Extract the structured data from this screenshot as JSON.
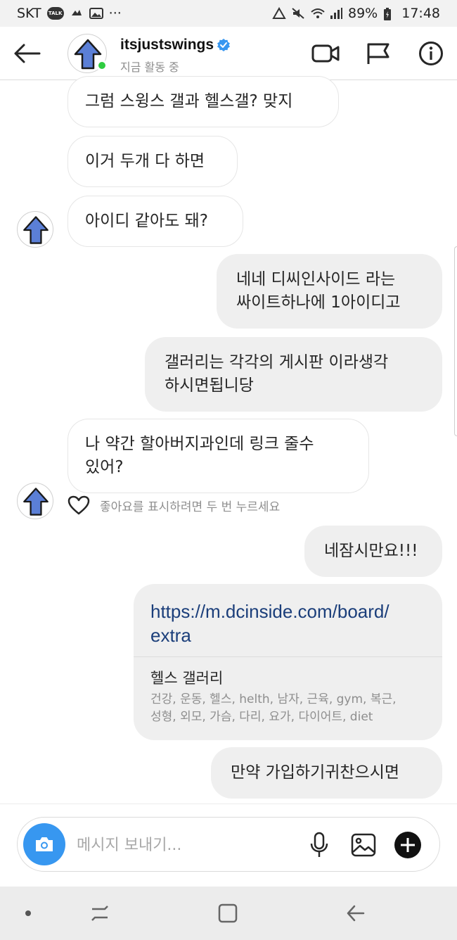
{
  "status_bar": {
    "carrier": "SKT",
    "talk_badge": "TALK",
    "battery": "89%",
    "time": "17:48",
    "more": "···"
  },
  "header": {
    "username": "itsjustswings",
    "activity_status": "지금 활동 중",
    "verified": true
  },
  "messages": [
    {
      "side": "in",
      "text": "그럼 스윙스 갤과 헬스갤? 맞지"
    },
    {
      "side": "in",
      "text": "이거 두개 다 하면"
    },
    {
      "side": "in",
      "text": "아이디 같아도 돼?"
    },
    {
      "side": "out",
      "lines": [
        "네네 디씨인사이드 라는",
        "싸이트하나에 1아이디고"
      ]
    },
    {
      "side": "out",
      "lines": [
        "갤러리는 각각의 게시판 이라생각",
        "하시면됩니당"
      ]
    },
    {
      "side": "in",
      "lines": [
        "나 약간 할아버지과인데 링크 줄수",
        "있어?"
      ]
    },
    {
      "side": "out",
      "text": "네잠시만요!!!"
    },
    {
      "side": "out",
      "text": "만약 가입하기귀찬으시면"
    }
  ],
  "like_hint": "좋아요를 표시하려면 두 번 누르세요",
  "link_card": {
    "url_lines": [
      "https://m.dcinside.com/board/",
      "extra"
    ],
    "title": "헬스 갤러리",
    "description_lines": [
      "건강, 운동, 헬스, helth, 남자, 근육, gym, 복근,",
      "성형, 외모, 가슴, 다리, 요가, 다이어트, diet"
    ]
  },
  "composer": {
    "placeholder": "메시지 보내기..."
  },
  "colors": {
    "accent_blue": "#3797f0",
    "verified_blue": "#3897f0",
    "online_green": "#2ecc40",
    "link_blue": "#1b3e7a",
    "avatar_arrow": "#5b7fd6"
  }
}
